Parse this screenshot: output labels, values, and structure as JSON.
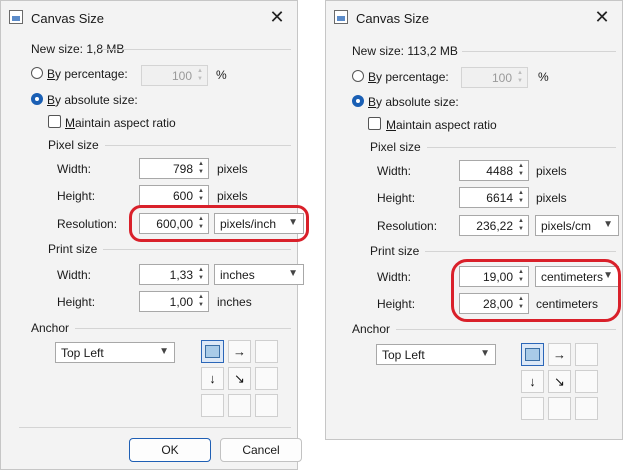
{
  "dialogs": [
    {
      "title": "Canvas Size",
      "new_size": "New size: 1,8 MB",
      "by_percentage_prefix": "B",
      "by_percentage_rest": "y percentage:",
      "percentage_value": "100",
      "percent_sign": "%",
      "by_absolute_prefix": "B",
      "by_absolute_rest": "y absolute size:",
      "maintain_prefix": "M",
      "maintain_rest": "aintain aspect ratio",
      "pixel_size": "Pixel size",
      "width_label": "Width:",
      "width_value": "798",
      "width_unit": "pixels",
      "height_label": "Height:",
      "height_value": "600",
      "height_unit": "pixels",
      "resolution_label": "Resolution:",
      "resolution_value": "600,00",
      "resolution_unit": "pixels/inch",
      "print_size": "Print size",
      "print_width_label": "Width:",
      "print_width_value": "1,33",
      "print_width_unit": "inches",
      "print_height_label": "Height:",
      "print_height_value": "1,00",
      "print_height_unit": "inches",
      "anchor": "Anchor",
      "anchor_value": "Top Left",
      "ok": "OK",
      "cancel": "Cancel"
    },
    {
      "title": "Canvas Size",
      "new_size": "New size: 113,2 MB",
      "by_percentage_prefix": "B",
      "by_percentage_rest": "y percentage:",
      "percentage_value": "100",
      "percent_sign": "%",
      "by_absolute_prefix": "B",
      "by_absolute_rest": "y absolute size:",
      "maintain_prefix": "M",
      "maintain_rest": "aintain aspect ratio",
      "pixel_size": "Pixel size",
      "width_label": "Width:",
      "width_value": "4488",
      "width_unit": "pixels",
      "height_label": "Height:",
      "height_value": "6614",
      "height_unit": "pixels",
      "resolution_label": "Resolution:",
      "resolution_value": "236,22",
      "resolution_unit": "pixels/cm",
      "print_size": "Print size",
      "print_width_label": "Width:",
      "print_width_value": "19,00",
      "print_width_unit": "centimeters",
      "print_height_label": "Height:",
      "print_height_value": "28,00",
      "print_height_unit": "centimeters",
      "anchor": "Anchor",
      "anchor_value": "Top Left"
    }
  ],
  "icons": {
    "close": "close-icon",
    "spin_up": "triangle-up-icon",
    "spin_down": "triangle-down-icon",
    "dropdown": "chevron-down-icon",
    "anchor_image": "image-icon",
    "arrow_right": "arrow-right-icon",
    "arrow_down": "arrow-down-icon",
    "arrow_down_right": "arrow-down-right-icon"
  },
  "colors": {
    "accent": "#1a5fb4",
    "highlight": "#d9202a",
    "dialog_bg": "#f3f3f3"
  }
}
